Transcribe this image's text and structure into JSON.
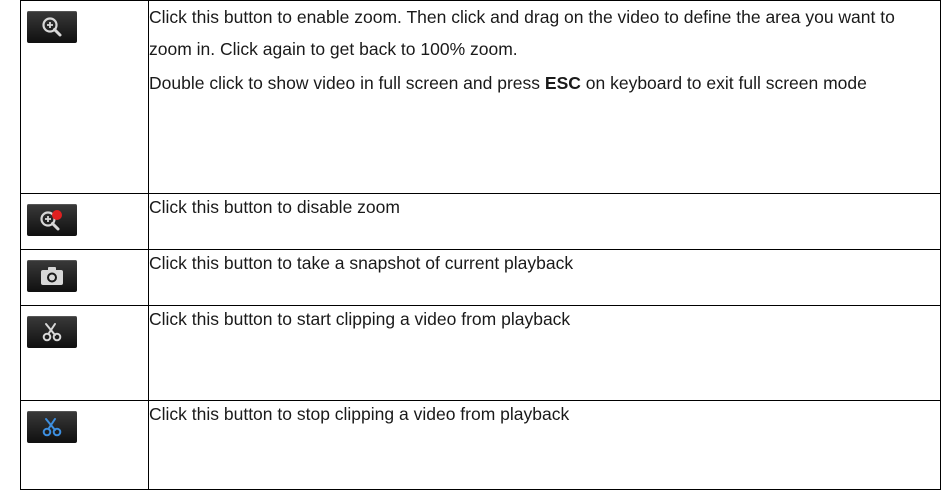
{
  "rows": [
    {
      "icon": "zoom-in-icon",
      "paragraph1": "Click this button to enable zoom. Then click and drag on the video to define the area you want to zoom in. Click again to get back to 100% zoom.",
      "paragraph2_before": "Double click to show video in full screen and press ",
      "paragraph2_bold": "ESC",
      "paragraph2_after": " on keyboard to exit full screen mode"
    },
    {
      "icon": "zoom-disable-icon",
      "text": "Click this button to disable zoom"
    },
    {
      "icon": "camera-icon",
      "text": "Click this button to take a snapshot of current playback"
    },
    {
      "icon": "scissors-icon",
      "text": "Click this button to start clipping a video from playback"
    },
    {
      "icon": "scissors-active-icon",
      "text": "Click this button to stop clipping a video from playback"
    }
  ],
  "colors": {
    "icon_gray": "#d8d8d8",
    "zoom_disable_dot": "#e02020",
    "scissors_active": "#3d8fe0",
    "button_bg": "#1a1a1a"
  }
}
